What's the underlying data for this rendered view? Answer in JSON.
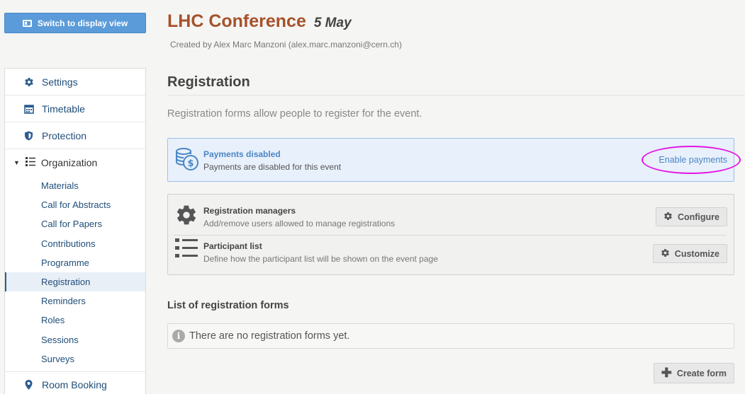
{
  "header": {
    "display_button": "Switch to display view",
    "event_title": "LHC Conference",
    "event_date": "5 May",
    "created_by": "Created by Alex Marc Manzoni (alex.marc.manzoni@cern.ch)"
  },
  "sidebar": {
    "settings": "Settings",
    "timetable": "Timetable",
    "protection": "Protection",
    "organization": "Organization",
    "sub_items": [
      "Materials",
      "Call for Abstracts",
      "Call for Papers",
      "Contributions",
      "Programme",
      "Registration",
      "Reminders",
      "Roles",
      "Sessions",
      "Surveys"
    ],
    "active_sub": "Registration",
    "room_booking": "Room Booking"
  },
  "main": {
    "section_title": "Registration",
    "intro": "Registration forms allow people to register for the event.",
    "payments": {
      "title": "Payments disabled",
      "subtitle": "Payments are disabled for this event",
      "link": "Enable payments"
    },
    "managers": {
      "title": "Registration managers",
      "subtitle": "Add/remove users allowed to manage registrations",
      "button": "Configure"
    },
    "participants": {
      "title": "Participant list",
      "subtitle": "Define how the participant list will be shown on the event page",
      "button": "Customize"
    },
    "forms_heading": "List of registration forms",
    "empty_message": "There are no registration forms yet.",
    "create_button": "Create form"
  },
  "colors": {
    "accent_blue": "#5b9bd9",
    "title_orange": "#a6522a",
    "highlight_ring": "#e414e6",
    "info_bg": "#e8f0fb"
  }
}
